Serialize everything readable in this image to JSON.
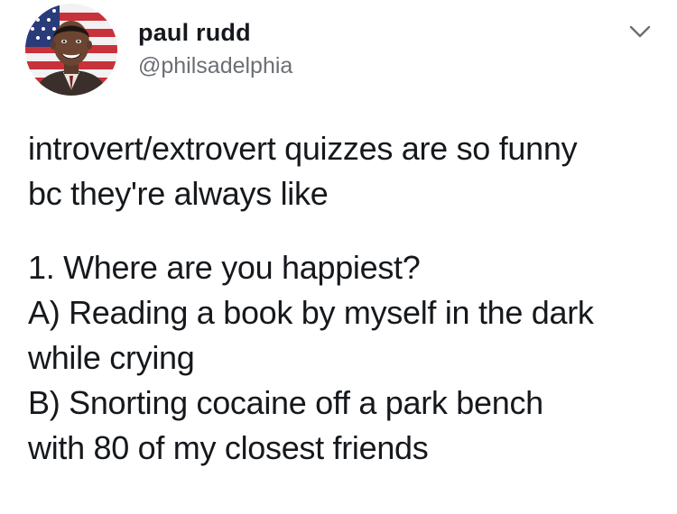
{
  "author": {
    "display_name": "paul rudd",
    "handle": "@philsadelphia",
    "avatar_icon": "profile-photo-avatar"
  },
  "menu": {
    "icon": "chevron-down-icon"
  },
  "tweet": {
    "paragraphs": [
      {
        "lines": [
          "introvert/extrovert quizzes are so funny",
          "bc they're always like"
        ]
      },
      {
        "lines": [
          "1. Where are you happiest?",
          "A) Reading a book by myself in the dark",
          "while crying",
          "B) Snorting cocaine off a park bench",
          "with 80 of my closest friends"
        ]
      }
    ]
  },
  "colors": {
    "text_primary": "#15181c",
    "text_secondary": "#6b6f74",
    "background": "#ffffff"
  }
}
